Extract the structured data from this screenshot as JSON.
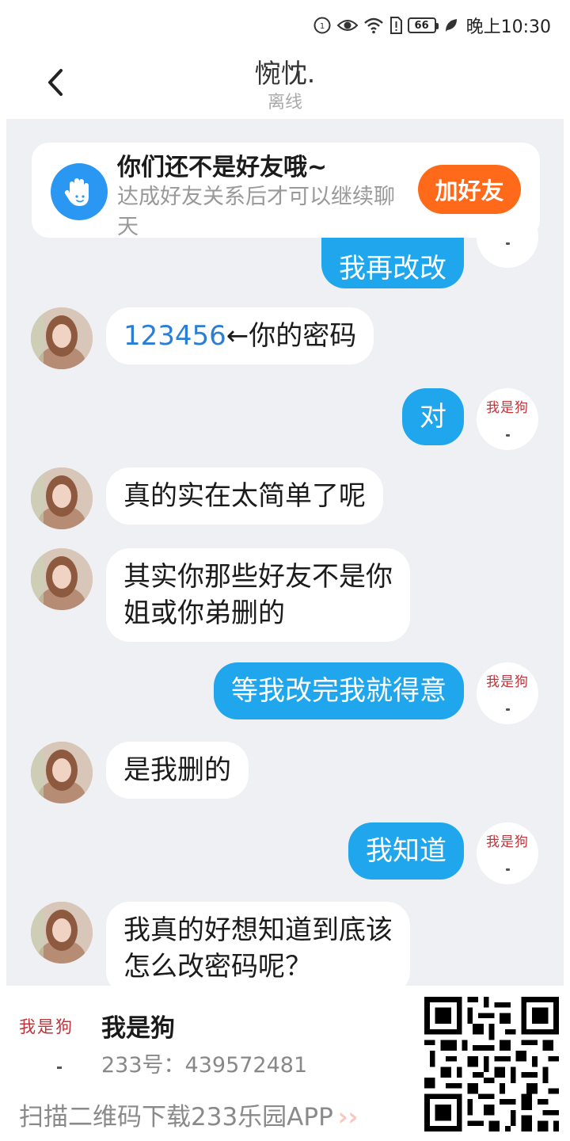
{
  "status_bar": {
    "time": "晚上10:30",
    "battery": "66",
    "icons": [
      "sim-1-icon",
      "eye-icon",
      "wifi-icon",
      "sim-alert-icon",
      "battery-icon",
      "leaf-icon"
    ]
  },
  "header": {
    "title": "惋忱.",
    "status": "离线",
    "back_icon": "chevron-left-icon"
  },
  "friend_card": {
    "title": "你们还不是好友哦~",
    "description": "达成好友关系后才可以继续聊天",
    "button": "加好友",
    "icon": "hand-icon"
  },
  "messages": [
    {
      "side": "right",
      "text": "我再改改"
    },
    {
      "side": "left",
      "link": "123456",
      "text": "←你的密码"
    },
    {
      "side": "right",
      "text": "对"
    },
    {
      "side": "left",
      "text": "真的实在太简单了呢"
    },
    {
      "side": "left",
      "line1": "其实你那些好友不是你",
      "line2": "姐或你弟删的"
    },
    {
      "side": "right",
      "text": "等我改完我就得意"
    },
    {
      "side": "left",
      "text": "是我删的"
    },
    {
      "side": "right",
      "text": "我知道"
    },
    {
      "side": "left",
      "line1": "我真的好想知道到底该",
      "line2": "怎么改密码呢？"
    }
  ],
  "self_avatar_text": "我是狗",
  "footer": {
    "logo_text": "我是狗",
    "name": "我是狗",
    "id_text": "233号：439572481",
    "cta": "扫描二维码下载233乐园APP",
    "cta_arrows": "››"
  },
  "colors": {
    "accent_blue": "#1fa6ec",
    "add_friend_orange": "#ff6a1a",
    "chat_bg": "#eef0f4",
    "stamp_red": "#c2343b"
  }
}
